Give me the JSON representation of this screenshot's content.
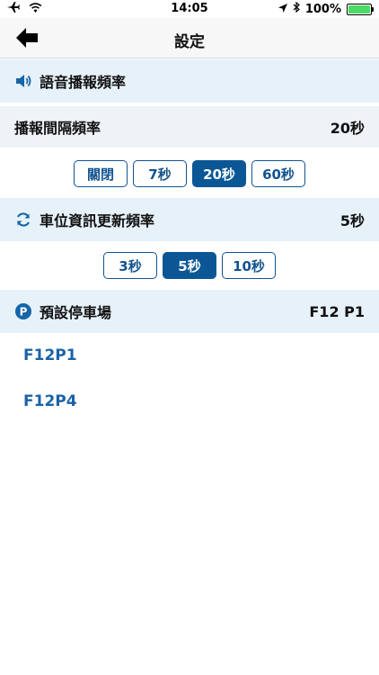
{
  "status": {
    "time": "14:05",
    "battery": "100%",
    "battery_level": 1.0
  },
  "nav": {
    "title": "設定"
  },
  "voice": {
    "section_label": "語音播報頻率",
    "interval_label": "播報間隔頻率",
    "interval_value": "20秒",
    "options": [
      "關閉",
      "7秒",
      "20秒",
      "60秒"
    ],
    "selected": "20秒"
  },
  "refresh": {
    "section_label": "車位資訊更新頻率",
    "value": "5秒",
    "options": [
      "3秒",
      "5秒",
      "10秒"
    ],
    "selected": "5秒"
  },
  "default_lot": {
    "section_label": "預設停車場",
    "value": "F12 P1",
    "lots": [
      "F12P1",
      "F12P4"
    ]
  },
  "colors": {
    "accent": "#0b5796",
    "section_bg": "#e6f1fa",
    "lot_text": "#1a63a8"
  }
}
